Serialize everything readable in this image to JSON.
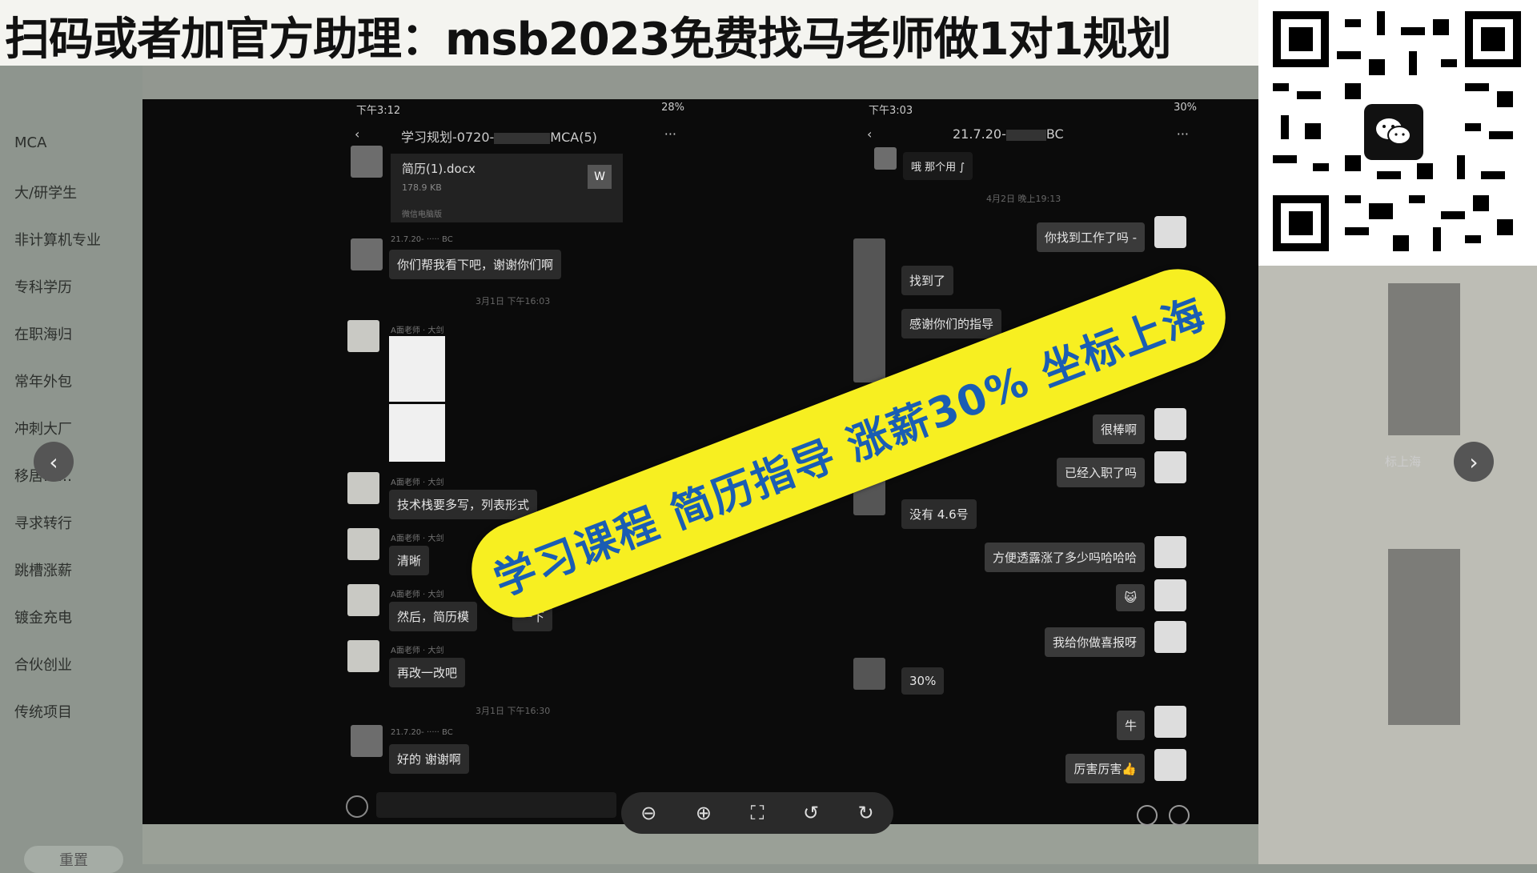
{
  "banner": {
    "text": "扫码或者加官方助理：msb2023免费找马老师做1对1规划"
  },
  "sidebar": {
    "items": [
      {
        "label": "MCA"
      },
      {
        "label": "大/研学生"
      },
      {
        "label": "非计算机专业"
      },
      {
        "label": "专科学历"
      },
      {
        "label": "在职海归"
      },
      {
        "label": "常年外包"
      },
      {
        "label": "冲刺大厂"
      },
      {
        "label": "移居……"
      },
      {
        "label": "寻求转行"
      },
      {
        "label": "跳槽涨薪"
      },
      {
        "label": "镀金充电"
      },
      {
        "label": "合伙创业"
      },
      {
        "label": "传统项目"
      }
    ],
    "reset_label": "重置"
  },
  "left_chat": {
    "status_time": "下午3:12",
    "status_battery": "28%",
    "title": "学习规划-0720-",
    "title_suffix": "MCA(5)",
    "file_name": "简历(1).docx",
    "file_size": "178.9 KB",
    "file_badge": "W",
    "file_source": "微信电脑版",
    "sender_tag": "21.7.20-",
    "sender_tag_suffix": "BC",
    "teacher_tag": "A面老师 · 大剑",
    "messages": [
      {
        "text": "你们帮我看下吧，谢谢你们啊"
      },
      {
        "text": "技术栈要多写，列表形式"
      },
      {
        "text": "清晰"
      },
      {
        "text": "然后，简历模"
      },
      {
        "text": "一下"
      },
      {
        "text": "再改一改吧"
      },
      {
        "text": "好的 谢谢啊"
      }
    ],
    "time1": "3月1日 下午16:03",
    "time2": "3月1日 下午16:30"
  },
  "right_chat": {
    "status_time": "下午3:03",
    "status_battery": "30%",
    "title": "21.7.20-",
    "title_suffix": "BC",
    "top_text": "哦 那个用 ∫",
    "time1": "4月2日 晚上19:13",
    "messages": [
      {
        "text": "你找到工作了吗 -",
        "side": "right"
      },
      {
        "text": "找到了",
        "side": "left"
      },
      {
        "text": "感谢你们的指导",
        "side": "left"
      },
      {
        "text": "很棒啊",
        "side": "right"
      },
      {
        "text": "已经入职了吗",
        "side": "right"
      },
      {
        "text": "没有 4.6号",
        "side": "left"
      },
      {
        "text": "方便透露涨了多少吗哈哈哈",
        "side": "right"
      },
      {
        "text": "😺",
        "side": "right"
      },
      {
        "text": "我给你做喜报呀",
        "side": "right"
      },
      {
        "text": "30%",
        "side": "left"
      },
      {
        "text": "牛",
        "side": "right"
      },
      {
        "text": "厉害厉害👍",
        "side": "right"
      }
    ]
  },
  "stamp": {
    "text": "学习课程 简历指导 涨薪30% 坐标上海"
  },
  "right_edge_text": "标上海",
  "toolbar": {
    "zoom_out": "⊖",
    "zoom_in": "⊕",
    "fit": "⛶",
    "rotate_left": "↺",
    "rotate_right": "↻"
  },
  "nav": {
    "prev": "‹",
    "next": "›"
  }
}
